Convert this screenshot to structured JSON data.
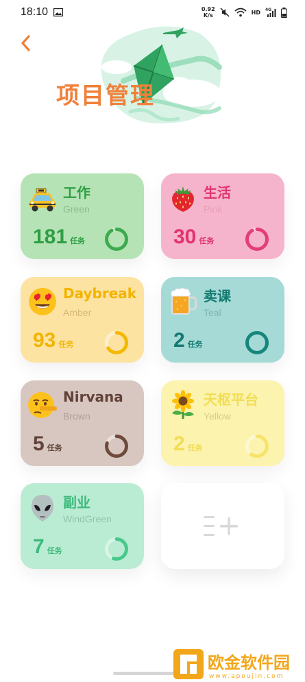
{
  "status_bar": {
    "time": "18:10",
    "net_speed_value": "0.92",
    "net_speed_unit": "K/s",
    "hd": "HD",
    "signal_label": "4G"
  },
  "header": {
    "title": "项目管理"
  },
  "projects": [
    {
      "name": "工作",
      "color_name": "Green",
      "count": "181",
      "unit": "任务",
      "bg": "#b6e3b5",
      "accent": "#3dab4f",
      "text": "#2e9e44",
      "sub": "#8cbf8c",
      "progress": 0.92
    },
    {
      "name": "生活",
      "color_name": "Pink",
      "count": "30",
      "unit": "任务",
      "bg": "#f5b4cc",
      "accent": "#e43e7a",
      "text": "#e2336d",
      "sub": "#e7a0b8",
      "progress": 0.92
    },
    {
      "name": "Daybreak",
      "color_name": "Amber",
      "count": "93",
      "unit": "任务",
      "bg": "#fde3a2",
      "accent": "#f5b800",
      "text": "#f2b400",
      "sub": "#d6b877",
      "progress": 0.66
    },
    {
      "name": "卖课",
      "color_name": "Teal",
      "count": "2",
      "unit": "任务",
      "bg": "#a5dad6",
      "accent": "#16867c",
      "text": "#137a71",
      "sub": "#7fb8b3",
      "progress": 1.0
    },
    {
      "name": "Nirvana",
      "color_name": "Brown",
      "count": "5",
      "unit": "任务",
      "bg": "#d8c7c1",
      "accent": "#6e4a3c",
      "text": "#614238",
      "sub": "#b09f99",
      "progress": 0.8
    },
    {
      "name": "天枢平台",
      "color_name": "Yellow",
      "count": "2",
      "unit": "任务",
      "bg": "#fbf3ae",
      "accent": "#f7e36a",
      "text": "#f1dd55",
      "sub": "#d7cf86",
      "progress": 0.6
    },
    {
      "name": "副业",
      "color_name": "WindGreen",
      "count": "7",
      "unit": "任务",
      "bg": "#b9ecd3",
      "accent": "#47c98a",
      "text": "#3dba7c",
      "sub": "#8fc4ab",
      "progress": 0.55
    }
  ],
  "emoji_icons": [
    "taxi-icon",
    "strawberry-icon",
    "heart-eyes-icon",
    "beer-mug-icon",
    "lying-face-icon",
    "sunflower-icon",
    "alien-icon"
  ],
  "add_card": {
    "icon": "add-list-icon"
  },
  "watermark": {
    "brand_text": "欧金软件园",
    "url": "www.apoujin.com"
  }
}
